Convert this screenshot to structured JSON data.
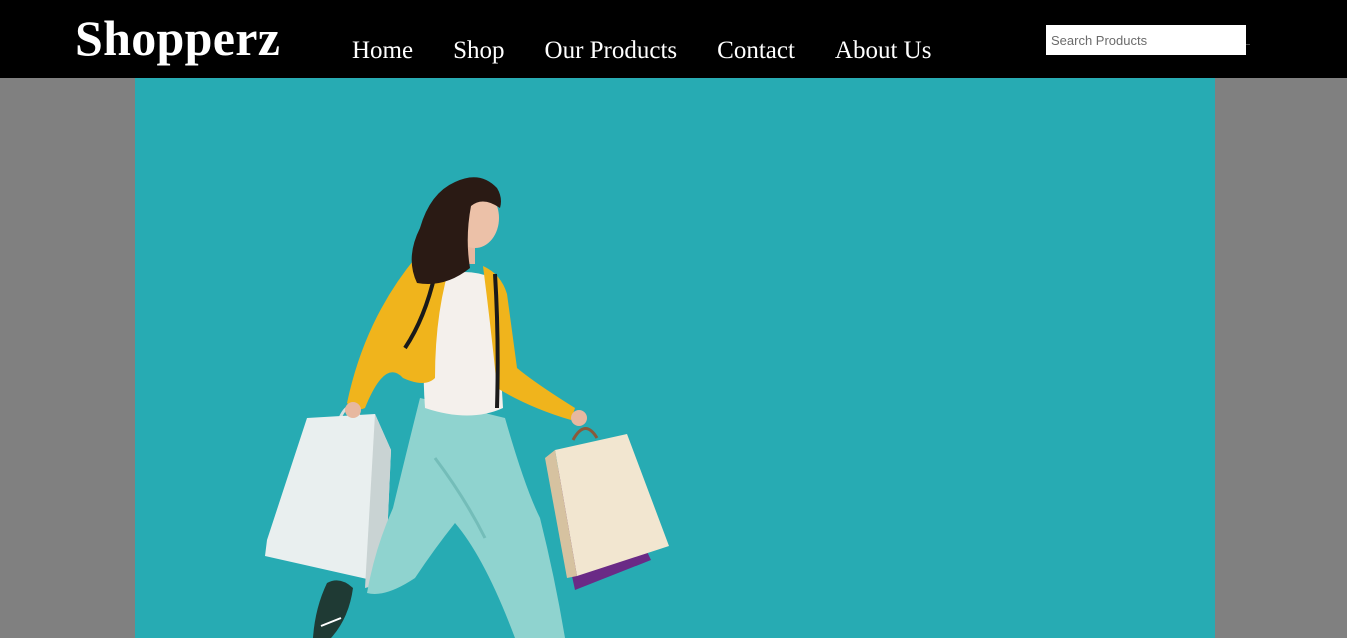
{
  "header": {
    "brand": "Shopperz",
    "nav": [
      {
        "label": "Home"
      },
      {
        "label": "Shop"
      },
      {
        "label": "Our Products"
      },
      {
        "label": "Contact"
      },
      {
        "label": "About Us"
      }
    ],
    "search": {
      "placeholder": "Search Products",
      "value": ""
    }
  },
  "hero": {
    "image": "woman-with-shopping-bags",
    "background_color": "#27abb3"
  },
  "colors": {
    "navbar": "#000000",
    "page_background": "#808080",
    "jacket": "#f0b41c",
    "pants": "#8fd3cf"
  }
}
